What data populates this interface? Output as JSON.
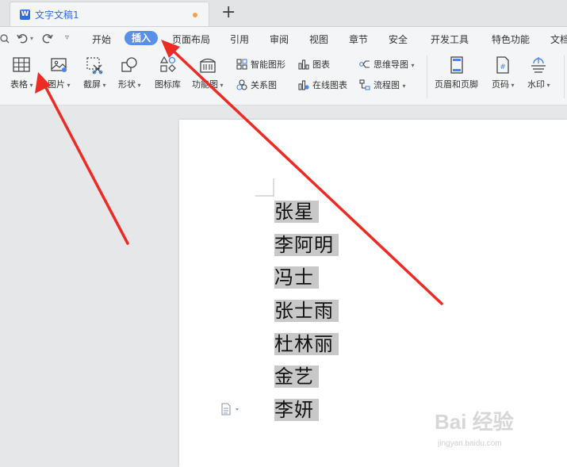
{
  "tab": {
    "title": "文字文稿1",
    "logo": "W",
    "new_tab": "+"
  },
  "menu": {
    "items": [
      "开始",
      "插入",
      "页面布局",
      "引用",
      "审阅",
      "视图",
      "章节",
      "安全",
      "开发工具",
      "特色功能",
      "文档"
    ],
    "active": "插入"
  },
  "ribbon": {
    "large": [
      {
        "label": "表格",
        "icon": "table-icon"
      },
      {
        "label": "图片",
        "icon": "picture-icon"
      },
      {
        "label": "截屏",
        "icon": "screenshot-icon"
      },
      {
        "label": "形状",
        "icon": "shapes-icon"
      },
      {
        "label": "图标库",
        "icon": "icon-library-icon"
      },
      {
        "label": "功能图",
        "icon": "function-chart-icon"
      },
      {
        "label": "页眉和页脚",
        "icon": "header-footer-icon"
      },
      {
        "label": "页码",
        "icon": "page-number-icon"
      },
      {
        "label": "水印",
        "icon": "watermark-icon"
      }
    ],
    "small": [
      {
        "label": "智能图形",
        "icon": "smart-art-icon"
      },
      {
        "label": "关系图",
        "icon": "relation-chart-icon"
      },
      {
        "label": "图表",
        "icon": "chart-icon"
      },
      {
        "label": "在线图表",
        "icon": "online-chart-icon"
      },
      {
        "label": "思维导图",
        "icon": "mind-map-icon"
      },
      {
        "label": "流程图",
        "icon": "flowchart-icon"
      }
    ]
  },
  "document": {
    "lines": [
      "张星",
      "李阿明",
      "冯士",
      "张士雨",
      "杜林丽",
      "金艺",
      "李妍"
    ]
  },
  "annotations": {
    "arrow_color": "#ee2a24"
  },
  "watermark": {
    "main": "Bai 经验",
    "sub": "jingyan.baidu.com"
  }
}
